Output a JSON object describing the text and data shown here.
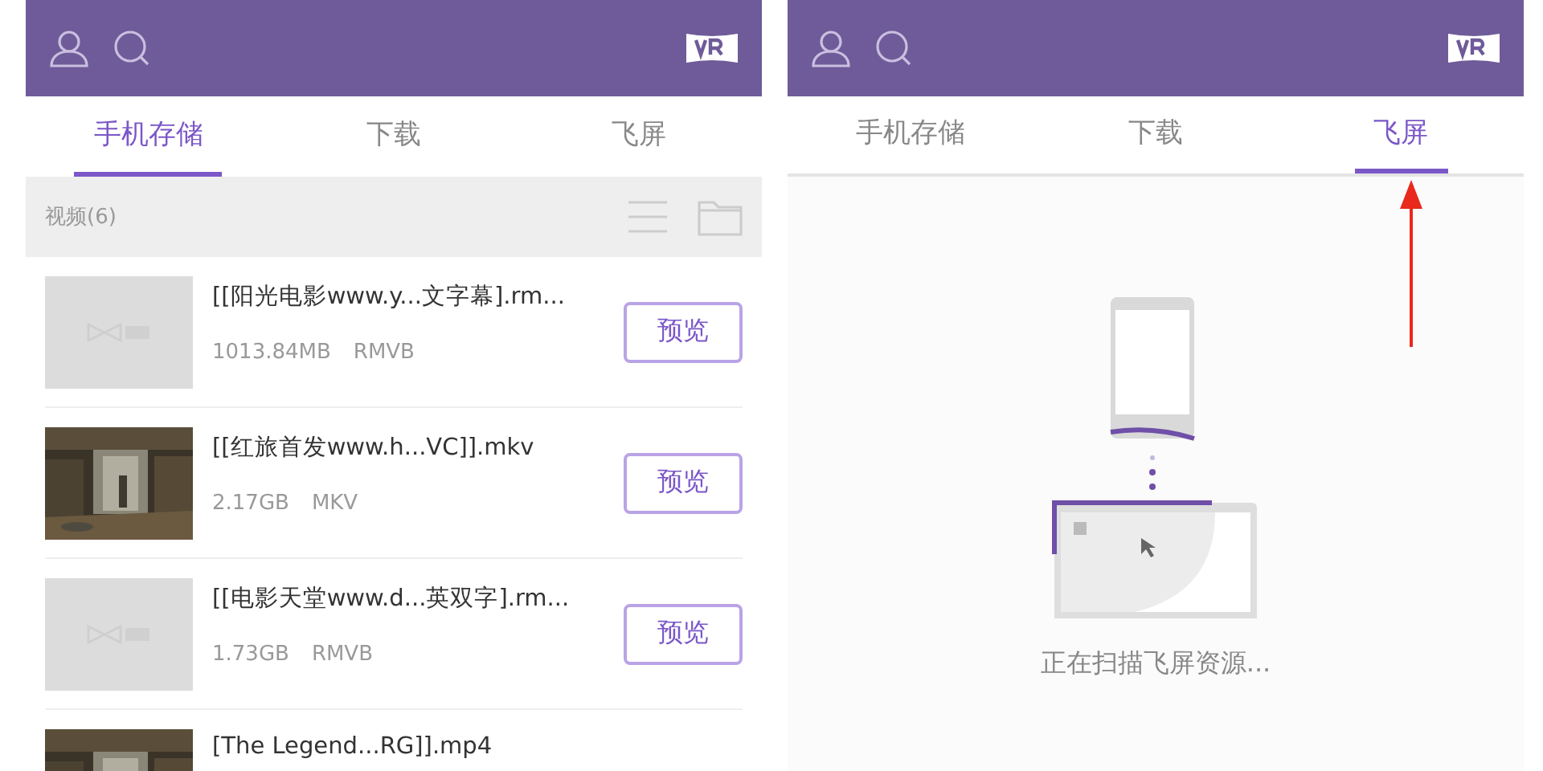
{
  "screens": [
    {
      "tabs": [
        {
          "label": "手机存储",
          "selected": true
        },
        {
          "label": "下载",
          "selected": false
        },
        {
          "label": "飞屏",
          "selected": false
        }
      ],
      "section": {
        "title": "视频(6)"
      },
      "videos": [
        {
          "title": "[[阳光电影www.y...文字幕].rm...",
          "size": "1013.84MB",
          "format": "RMVB",
          "kind": "placeholder",
          "button": "预览"
        },
        {
          "title": "[[红旅首发www.h...VC]].mkv",
          "size": "2.17GB",
          "format": "MKV",
          "kind": "picture",
          "button": "预览"
        },
        {
          "title": "[[电影天堂www.d...英双字].rm...",
          "size": "1.73GB",
          "format": "RMVB",
          "kind": "placeholder",
          "button": "预览"
        },
        {
          "title": "[The Legend...RG]].mp4",
          "kind": "picture"
        }
      ]
    },
    {
      "tabs": [
        {
          "label": "手机存储",
          "selected": false
        },
        {
          "label": "下载",
          "selected": false
        },
        {
          "label": "飞屏",
          "selected": true
        }
      ],
      "status": "正在扫描飞屏资源...",
      "annotation": {
        "kind": "arrow"
      }
    }
  ]
}
